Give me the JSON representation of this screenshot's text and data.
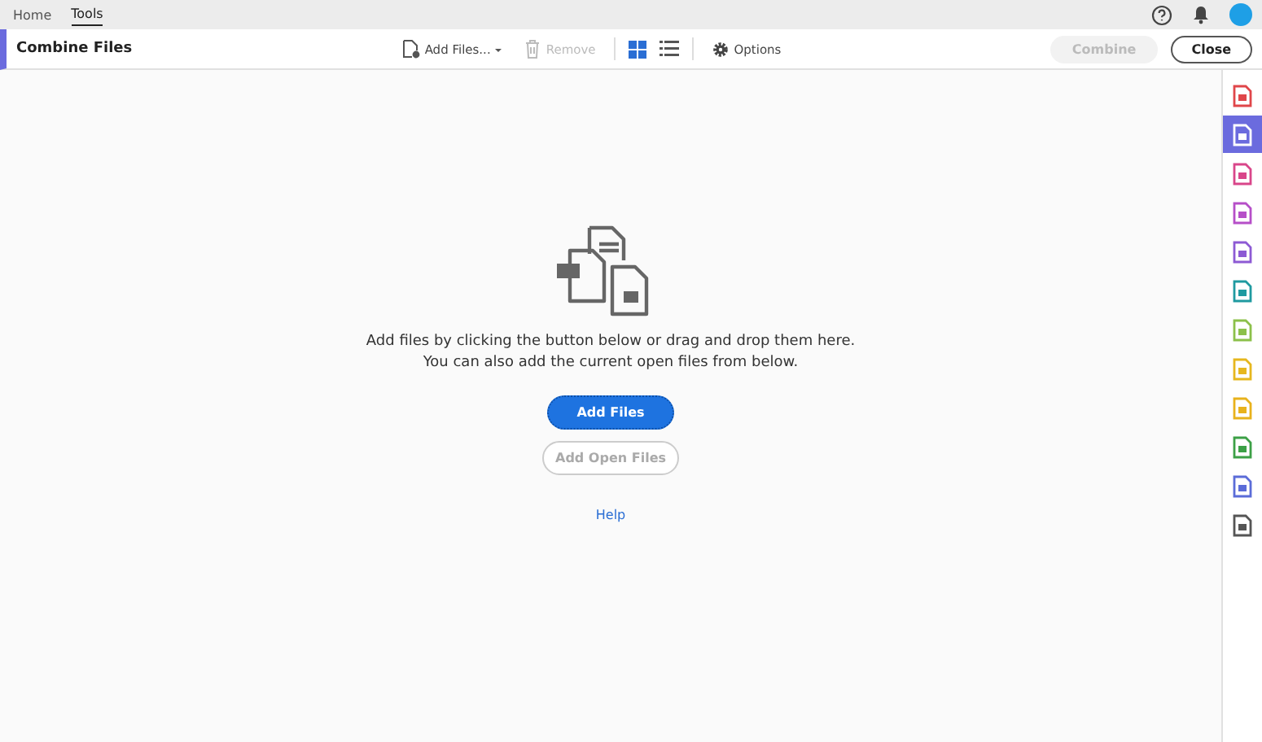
{
  "top_tabs": [
    {
      "label": "Home",
      "selected": false
    },
    {
      "label": "Tools",
      "selected": true
    }
  ],
  "toolbar": {
    "title": "Combine Files",
    "add_files": {
      "label": "Add Files...",
      "disabled": false
    },
    "remove": {
      "label": "Remove",
      "disabled": true
    },
    "views": [
      {
        "kind": "grid",
        "selected": true
      },
      {
        "kind": "list",
        "selected": false
      }
    ],
    "options": "Options",
    "combine": {
      "label": "Combine",
      "disabled": true
    },
    "close": "Close"
  },
  "main": {
    "message": "Add files by clicking the button below or drag and drop them here.",
    "message_2": "You can also add the current open files from below.",
    "add_files": {
      "label": "Add Files",
      "disabled": false
    },
    "add_open_files": {
      "label": "Add Open Files",
      "disabled": true
    },
    "help": "Help"
  },
  "right_rail": [
    {
      "color": "#e0464a",
      "selected": false
    },
    {
      "color": "#6b6bde",
      "selected": true
    },
    {
      "color": "#d9468a",
      "selected": false
    },
    {
      "color": "#b64fc8",
      "selected": false
    },
    {
      "color": "#8d5ad4",
      "selected": false
    },
    {
      "color": "#1f9aa0",
      "selected": false
    },
    {
      "color": "#8cc04a",
      "selected": false
    },
    {
      "color": "#e6b71e",
      "selected": false
    },
    {
      "color": "#e8b21c",
      "selected": false
    },
    {
      "color": "#3ca046",
      "selected": false
    },
    {
      "color": "#5b6cd8",
      "selected": false
    },
    {
      "color": "#555555",
      "selected": false
    }
  ]
}
